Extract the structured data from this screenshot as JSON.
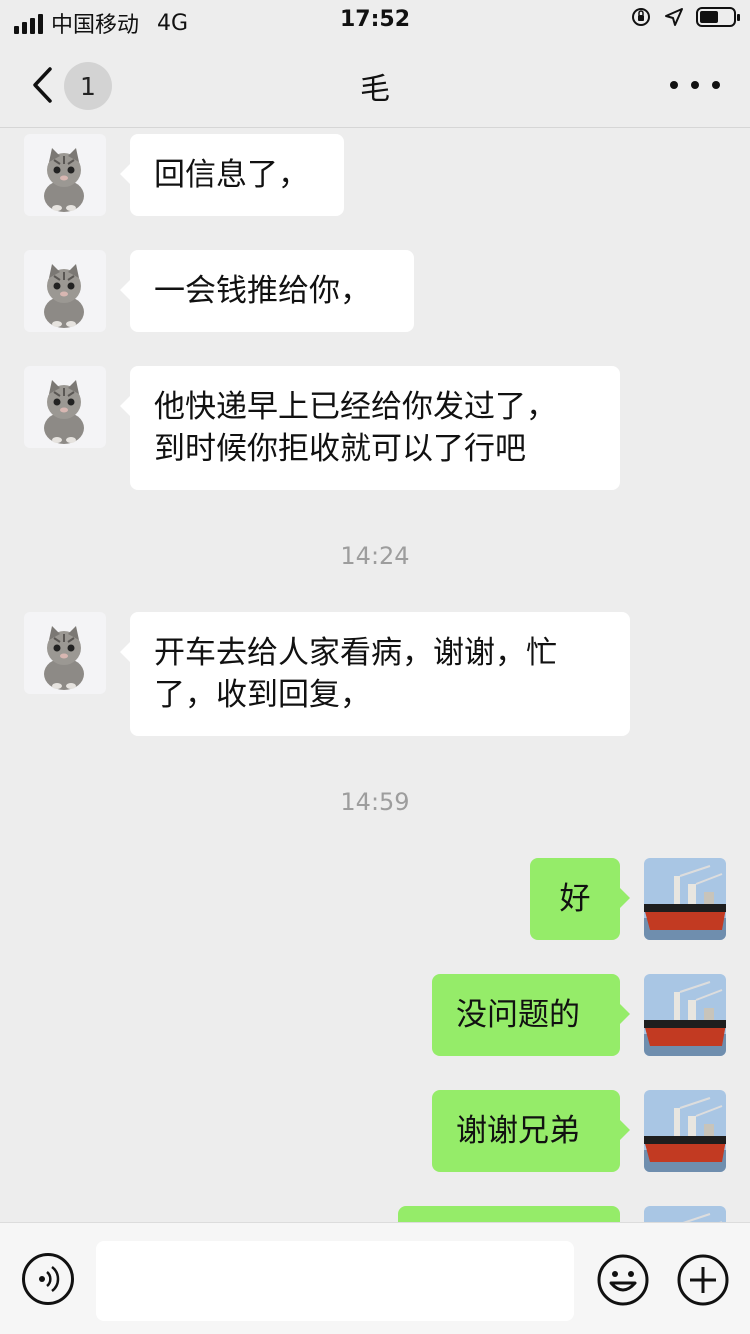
{
  "status_bar": {
    "carrier": "中国移动",
    "network": "4G",
    "time": "17:52",
    "icons": [
      "signal-icon",
      "orientation-lock-icon",
      "location-icon",
      "battery-icon"
    ]
  },
  "nav": {
    "unread_badge": "1",
    "title": "毛",
    "icons": [
      "back-chevron-icon",
      "more-dots-icon"
    ]
  },
  "messages": [
    {
      "side": "left",
      "avatar": "kitten-avatar",
      "text": "回信息了，"
    },
    {
      "side": "left",
      "avatar": "kitten-avatar",
      "text": "一会钱推给你，"
    },
    {
      "side": "left",
      "avatar": "kitten-avatar",
      "lines": [
        "他快递早上已经给你发过了，",
        "到时候你拒收就可以了行吧"
      ]
    },
    {
      "timestamp": "14:24"
    },
    {
      "side": "left",
      "avatar": "kitten-avatar",
      "lines": [
        "开车去给人家看病，谢谢，忙",
        "了，收到回复，"
      ]
    },
    {
      "timestamp": "14:59"
    },
    {
      "side": "right",
      "avatar": "ship-avatar",
      "text": "好"
    },
    {
      "side": "right",
      "avatar": "ship-avatar",
      "text": "没问题的"
    },
    {
      "side": "right",
      "avatar": "ship-avatar",
      "text": "谢谢兄弟"
    },
    {
      "side": "right",
      "avatar": "ship-avatar",
      "text": ""
    }
  ],
  "input_bar": {
    "input_value": "",
    "icons": [
      "voice-icon",
      "emoji-icon",
      "plus-icon"
    ]
  },
  "colors": {
    "background": "#ededed",
    "incoming_bubble": "#ffffff",
    "outgoing_bubble": "#95ec69",
    "timestamp_text": "#9d9d9d"
  }
}
